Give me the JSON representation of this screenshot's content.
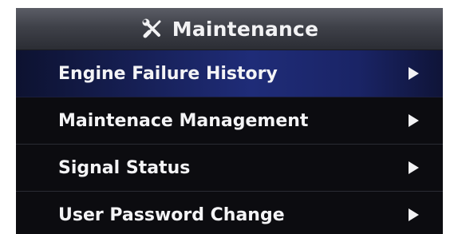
{
  "header": {
    "title": "Maintenance",
    "icon": "tools-icon"
  },
  "menu": {
    "selected_index": 0,
    "items": [
      {
        "label": "Engine Failure History",
        "icon": "chevron-right-icon"
      },
      {
        "label": "Maintenace Management",
        "icon": "chevron-right-icon"
      },
      {
        "label": "Signal Status",
        "icon": "chevron-right-icon"
      },
      {
        "label": "User Password Change",
        "icon": "chevron-right-icon"
      }
    ]
  },
  "colors": {
    "title_bar": "#3f4149",
    "selected_row": "#1f2c78",
    "background": "#0b0b0f",
    "text": "#f4f4f6"
  }
}
